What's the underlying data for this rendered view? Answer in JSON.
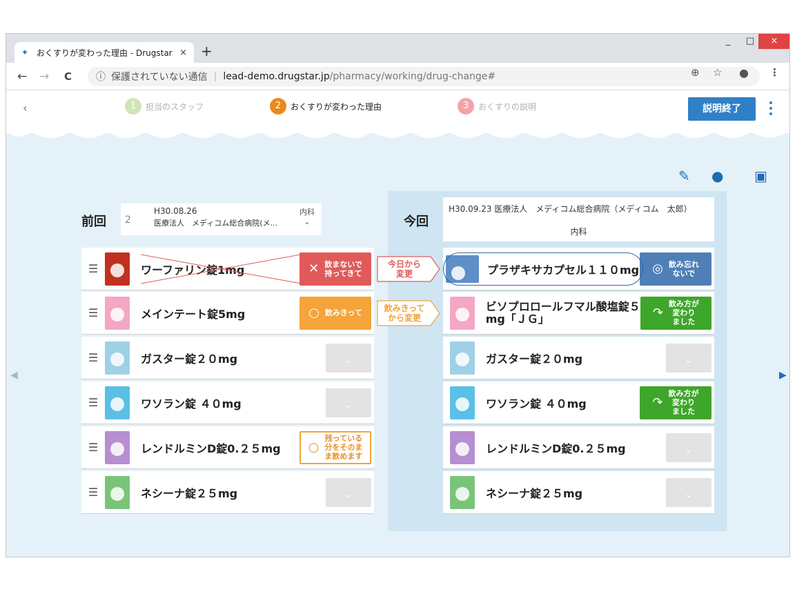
{
  "browser": {
    "tab_title": "おくすりが変わった理由 - Drugstar",
    "tab_close": "×",
    "new_tab": "+",
    "min": "_",
    "max": "□",
    "close": "×",
    "nav_back": "←",
    "nav_forward": "→",
    "nav_reload": "C",
    "security_text": "保護されていない通信",
    "url_host": "lead-demo.drugstar.jp",
    "url_path": "/pharmacy/working/drug-change#"
  },
  "header": {
    "back": "‹",
    "steps": [
      {
        "num": "1",
        "label": "担当のスタッフ"
      },
      {
        "num": "2",
        "label": "おくすりが変わった理由"
      },
      {
        "num": "3",
        "label": "おくすりの説明"
      }
    ],
    "end_button": "説明終了"
  },
  "previous": {
    "label": "前回",
    "count": "2",
    "date": "H30.08.26",
    "hospital": "医療法人　メディコム総合病院(メ...",
    "dept": "内科",
    "dept_chevron": "⌄",
    "items": [
      {
        "name": "ワーファリン錠1mg",
        "badge": "飲まないで持ってきて",
        "badge_line1": "飲まないで",
        "badge_line2": "持ってきて"
      },
      {
        "name": "メインテート錠5mg",
        "badge": "飲みきって"
      },
      {
        "name": "ガスター錠２０mg"
      },
      {
        "name": "ワソラン錠 ４０mg"
      },
      {
        "name": "レンドルミンD錠0.２５mg",
        "badge_line1": "残っている",
        "badge_line2": "分をそのま",
        "badge_line3": "ま飲めます"
      },
      {
        "name": "ネシーナ錠２５mg"
      }
    ]
  },
  "current": {
    "label": "今回",
    "header_line": "H30.09.23 医療法人　メディコム総合病院（メディコム　太郎）",
    "dept": "内科",
    "items": [
      {
        "name": "プラザキサカプセル１１０mg",
        "badge_line1": "飲み忘れ",
        "badge_line2": "ないで"
      },
      {
        "name_line1": "ビソプロロールフマル酸塩錠５",
        "name_line2": "mg「ＪＧ」",
        "badge_line1": "飲み方が",
        "badge_line2": "変わり",
        "badge_line3": "ました"
      },
      {
        "name": "ガスター錠２０mg"
      },
      {
        "name": "ワソラン錠 ４０mg",
        "badge_line1": "飲み方が",
        "badge_line2": "変わり",
        "badge_line3": "ました"
      },
      {
        "name": "レンドルミンD錠0.２５mg"
      },
      {
        "name": "ネシーナ錠２５mg"
      }
    ]
  },
  "arrows": [
    {
      "line1": "今日から",
      "line2": "変更"
    },
    {
      "line1": "飲みきって",
      "line2": "から変更"
    }
  ],
  "colors": {
    "primary": "#2f80c7",
    "red_badge": "#e15a5a",
    "orange_badge": "#f4a43a",
    "green_badge": "#3ea62a",
    "blue_badge": "#4f7fb6",
    "background": "#e4f1f8"
  },
  "icons": {
    "memo": "memo-edit-icon",
    "consult": "user-chat-icon",
    "print": "printer-icon",
    "dropdown": "chevron-down-icon"
  }
}
